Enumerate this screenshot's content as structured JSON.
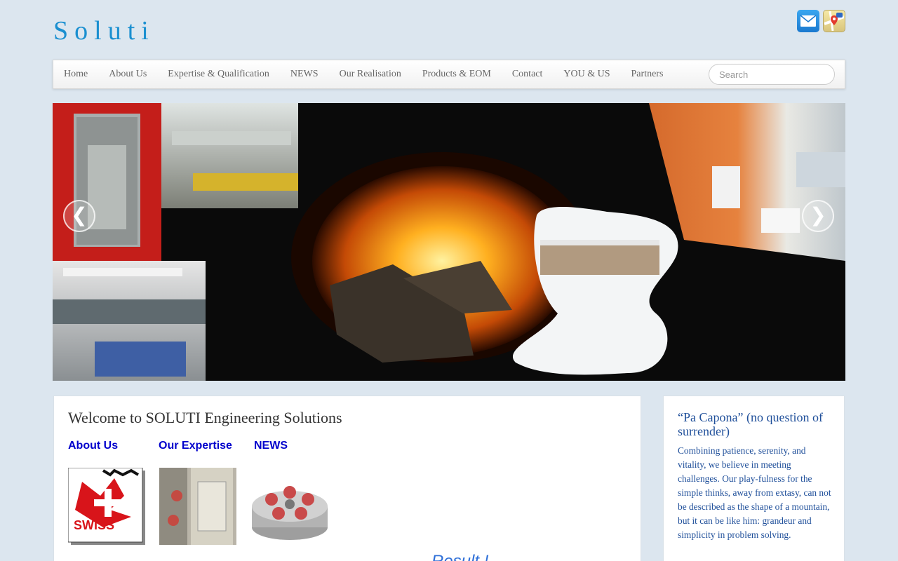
{
  "site": {
    "logo": "Soluti"
  },
  "nav": {
    "items": [
      "Home",
      "About Us",
      "Expertise & Qualification",
      "NEWS",
      "Our Realisation",
      "Products & EOM",
      "Contact",
      "YOU & US",
      "Partners"
    ],
    "search_placeholder": "Search"
  },
  "slider": {
    "prev": "❮",
    "next": "❯"
  },
  "main": {
    "title": "Welcome to SOLUTI Engineering Solutions",
    "links": [
      "About Us",
      "Our Expertise",
      "NEWS"
    ],
    "swiss_badge": "SWISS",
    "cut_heading": "...Result !..."
  },
  "sidebar": {
    "title": "“Pa Capona” (no question of surrender)",
    "text": "Combining patience, serenity, and vitality, we believe in meeting challenges. Our play-fulness for the simple thinks, away from extasy, can not be described as the shape of a mountain, but it can be like him: grandeur and simplicity in problem solving."
  },
  "colors": {
    "logo": "#1a8fd0",
    "link": "#0000cc",
    "sidebar_text": "#1f4f9a",
    "background": "#dce6ef"
  }
}
